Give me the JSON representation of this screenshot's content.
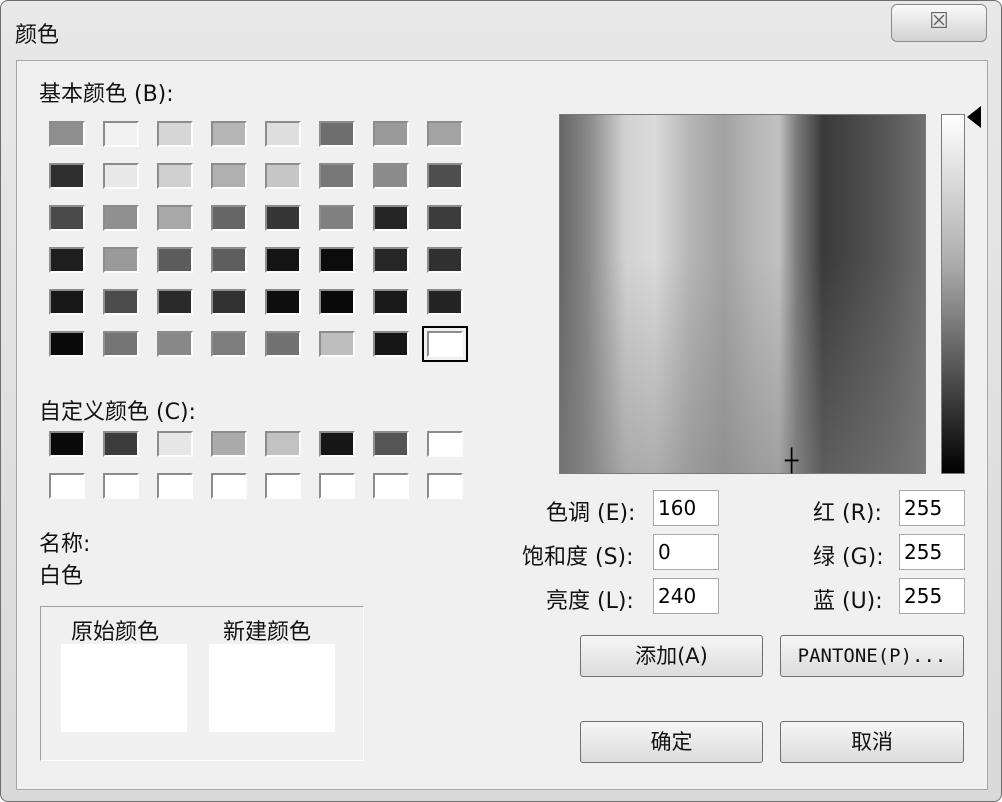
{
  "window": {
    "title": "颜色",
    "close_glyph": "☒"
  },
  "basic": {
    "label": "基本颜色 (B):",
    "colors": [
      [
        "#8e8e8e",
        "#f2f2f2",
        "#d6d6d6",
        "#b5b5b5",
        "#dedede",
        "#6e6e6e",
        "#9a9a9a",
        "#a3a3a3"
      ],
      [
        "#2e2e2e",
        "#e8e8e8",
        "#d0d0d0",
        "#b0b0b0",
        "#c6c6c6",
        "#787878",
        "#8c8c8c",
        "#4e4e4e"
      ],
      [
        "#4a4a4a",
        "#909090",
        "#a8a8a8",
        "#666666",
        "#363636",
        "#808080",
        "#252525",
        "#3c3c3c"
      ],
      [
        "#1e1e1e",
        "#9a9a9a",
        "#5c5c5c",
        "#5e5e5e",
        "#141414",
        "#0c0c0c",
        "#262626",
        "#303030"
      ],
      [
        "#181818",
        "#4c4c4c",
        "#2a2a2a",
        "#323232",
        "#0e0e0e",
        "#0a0a0a",
        "#1a1a1a",
        "#242424"
      ],
      [
        "#0a0a0a",
        "#747474",
        "#888888",
        "#7e7e7e",
        "#727272",
        "#bebebe",
        "#161616",
        "#ffffff"
      ]
    ]
  },
  "custom": {
    "label": "自定义颜色 (C):",
    "colors": [
      [
        "#0a0a0a",
        "#3c3c3c",
        "#e6e6e6",
        "#ababab",
        "#c2c2c2",
        "#161616",
        "#555555",
        "#ffffff"
      ],
      [
        "#ffffff",
        "#ffffff",
        "#ffffff",
        "#ffffff",
        "#ffffff",
        "#ffffff",
        "#ffffff",
        "#ffffff"
      ]
    ]
  },
  "name": {
    "label": "名称:",
    "value": "白色"
  },
  "preview": {
    "original_label": "原始颜色",
    "new_label": "新建颜色",
    "original_color": "#ffffff",
    "new_color": "#ffffff"
  },
  "fields": {
    "hue": {
      "label": "色调 (E):",
      "value": "160"
    },
    "saturation": {
      "label": "饱和度 (S):",
      "value": "0"
    },
    "luminance": {
      "label": "亮度 (L):",
      "value": "240"
    },
    "red": {
      "label": "红 (R):",
      "value": "255"
    },
    "green": {
      "label": "绿 (G):",
      "value": "255"
    },
    "blue": {
      "label": "蓝 (U):",
      "value": "255"
    }
  },
  "buttons": {
    "add": "添加(A)",
    "pantone": "PANTONE(P)...",
    "ok": "确定",
    "cancel": "取消"
  },
  "selected_basic_index": [
    5,
    7
  ]
}
